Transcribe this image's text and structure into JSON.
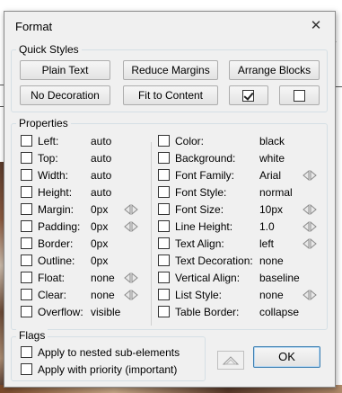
{
  "dialog": {
    "title": "Format"
  },
  "quick_styles": {
    "title": "Quick Styles",
    "buttons": [
      "Plain Text",
      "Reduce Margins",
      "Arrange Blocks",
      "No Decoration",
      "Fit to Content"
    ],
    "toggle_checked": true,
    "toggle_unchecked": false
  },
  "properties": {
    "title": "Properties",
    "left": [
      {
        "label": "Left:",
        "value": "auto",
        "stepper": false
      },
      {
        "label": "Top:",
        "value": "auto",
        "stepper": false
      },
      {
        "label": "Width:",
        "value": "auto",
        "stepper": false
      },
      {
        "label": "Height:",
        "value": "auto",
        "stepper": false
      },
      {
        "label": "Margin:",
        "value": "0px",
        "stepper": true
      },
      {
        "label": "Padding:",
        "value": "0px",
        "stepper": true
      },
      {
        "label": "Border:",
        "value": "0px",
        "stepper": false
      },
      {
        "label": "Outline:",
        "value": "0px",
        "stepper": false
      },
      {
        "label": "Float:",
        "value": "none",
        "stepper": true
      },
      {
        "label": "Clear:",
        "value": "none",
        "stepper": true
      },
      {
        "label": "Overflow:",
        "value": "visible",
        "stepper": false
      }
    ],
    "right": [
      {
        "label": "Color:",
        "value": "black",
        "stepper": false
      },
      {
        "label": "Background:",
        "value": "white",
        "stepper": false
      },
      {
        "label": "Font Family:",
        "value": "Arial",
        "stepper": true
      },
      {
        "label": "Font Style:",
        "value": "normal",
        "stepper": false
      },
      {
        "label": "Font Size:",
        "value": "10px",
        "stepper": true
      },
      {
        "label": "Line Height:",
        "value": "1.0",
        "stepper": true
      },
      {
        "label": "Text Align:",
        "value": "left",
        "stepper": true
      },
      {
        "label": "Text Decoration:",
        "value": "none",
        "stepper": false
      },
      {
        "label": "Vertical Align:",
        "value": "baseline",
        "stepper": false
      },
      {
        "label": "List Style:",
        "value": "none",
        "stepper": true
      },
      {
        "label": "Table Border:",
        "value": "collapse",
        "stepper": false
      }
    ]
  },
  "flags": {
    "title": "Flags",
    "items": [
      "Apply to nested sub-elements",
      "Apply with priority (important)"
    ]
  },
  "ok_label": "OK",
  "icons": {
    "close": "close-icon",
    "up": "up-arrow-icon",
    "stepper": "left-right-stepper-icon"
  },
  "colors": {
    "dialog_bg": "#f0f0f0",
    "group_border": "#d5dfe5",
    "ok_border": "#3c7fb1"
  }
}
